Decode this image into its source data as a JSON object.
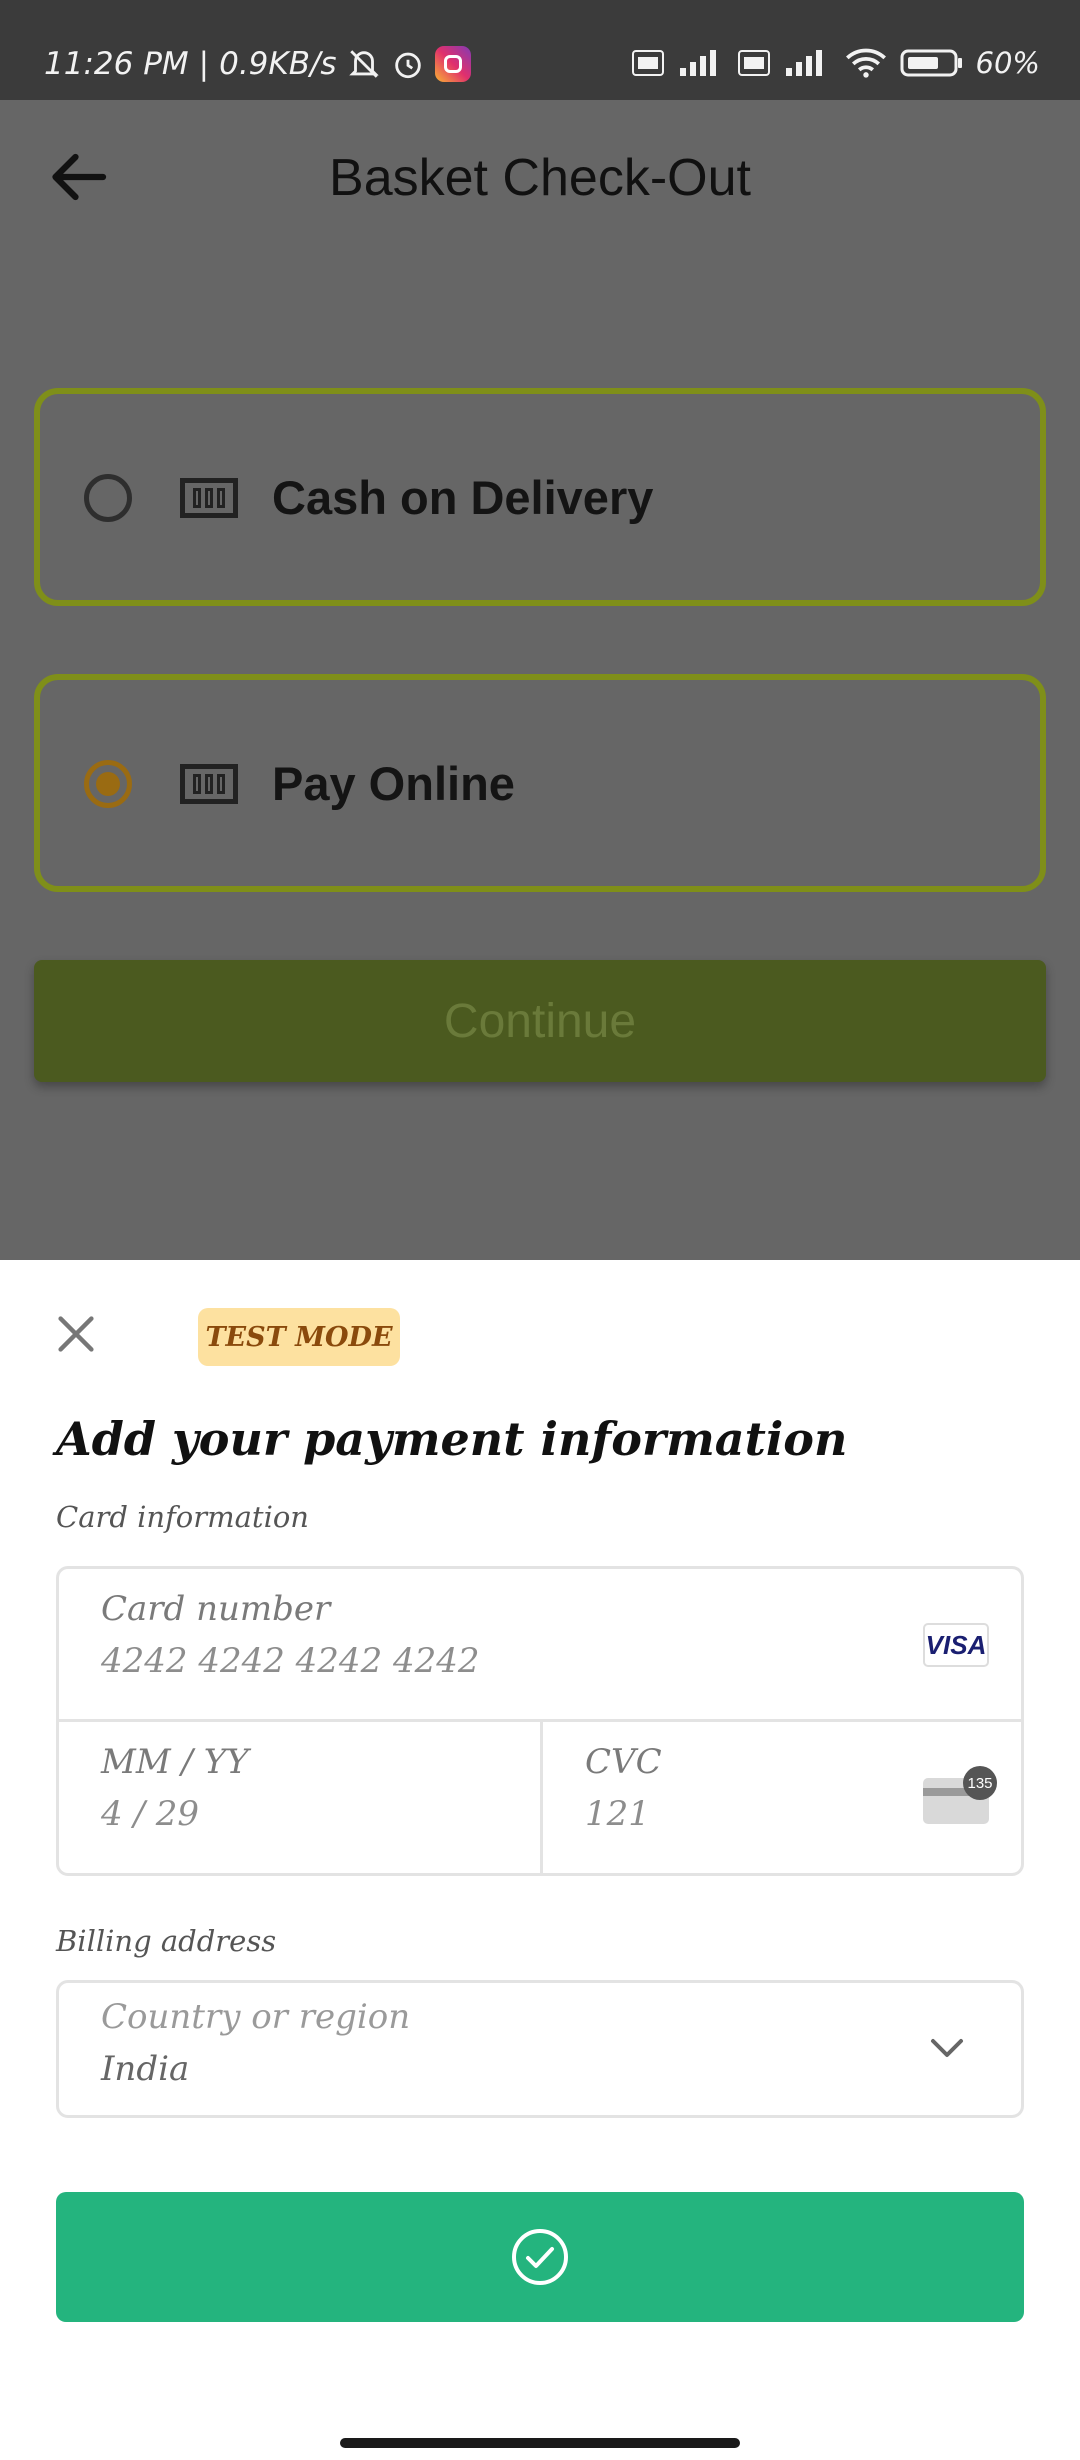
{
  "status_bar": {
    "time": "11:26 PM",
    "separator": "|",
    "speed": "0.9KB/s",
    "battery": "60%",
    "icons": [
      "mute-icon",
      "alarm-icon",
      "instagram-icon",
      "volte-icon",
      "4g-icon",
      "signal-icon",
      "wifi-icon",
      "battery-icon"
    ]
  },
  "header": {
    "title": "Basket Check-Out"
  },
  "payment_options": [
    {
      "label": "Cash on Delivery",
      "selected": false
    },
    {
      "label": "Pay Online",
      "selected": true
    }
  ],
  "continue_label": "Continue",
  "sheet": {
    "badge": "TEST MODE",
    "title": "Add your payment information",
    "card_section_label": "Card information",
    "card_number": {
      "label": "Card number",
      "value": "4242 4242 4242 4242",
      "brand": "VISA"
    },
    "expiry": {
      "label": "MM / YY",
      "value": "4 / 29"
    },
    "cvc": {
      "label": "CVC",
      "value": "121",
      "icon_badge": "135"
    },
    "billing_section_label": "Billing address",
    "country": {
      "label": "Country or region",
      "value": "India"
    },
    "submit_icon": "check-circle-icon"
  },
  "colors": {
    "overlay_bg": "#666666",
    "option_border": "#7f8f19",
    "radio_selected": "#9a6b12",
    "continue_bg": "#4b5a1f",
    "badge_bg": "#fde1a0",
    "badge_text": "#8a4a0c",
    "pay_button": "#24b47e"
  }
}
